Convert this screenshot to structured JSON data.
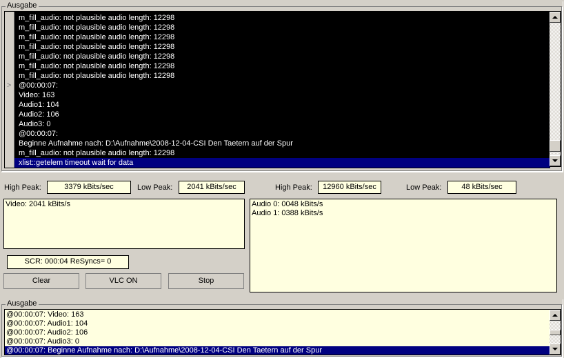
{
  "top_group": {
    "title": "Ausgabe",
    "console": {
      "gutter_marker": ">",
      "lines": [
        "m_fill_audio: not plausible audio length: 12298",
        "m_fill_audio: not plausible audio length: 12298",
        "m_fill_audio: not plausible audio length: 12298",
        "m_fill_audio: not plausible audio length: 12298",
        "m_fill_audio: not plausible audio length: 12298",
        "m_fill_audio: not plausible audio length: 12298",
        "m_fill_audio: not plausible audio length: 12298",
        "@00:00:07:",
        "Video: 163",
        "Audio1: 104",
        "Audio2: 106",
        "Audio3: 0",
        "@00:00:07:",
        "Beginne Aufnahme nach: D:\\Aufnahme\\2008-12-04-CSI Den Taetern auf der Spur",
        "m_fill_audio: not plausible audio length: 12298",
        "xlist::getelem timeout wait for data"
      ],
      "selected_line_index": 15
    }
  },
  "stats": {
    "video_high_peak_label": "High Peak:",
    "video_high_peak_value": "3379 kBits/sec",
    "video_low_peak_label": "Low Peak:",
    "video_low_peak_value": "2041 kBits/sec",
    "audio_high_peak_label": "High Peak:",
    "audio_high_peak_value": "12960 kBits/sec",
    "audio_low_peak_label": "Low Peak:",
    "audio_low_peak_value": "48 kBits/sec",
    "video_panel_lines": [
      "Video: 2041 kBits/s"
    ],
    "audio_panel_lines": [
      "Audio 0: 0048 kBits/s",
      "Audio 1: 0388 kBits/s"
    ],
    "scr_value": "SCR: 000:04 ReSyncs= 0"
  },
  "buttons": {
    "clear": "Clear",
    "vlc": "VLC ON",
    "stop": "Stop"
  },
  "bottom_group": {
    "title": "Ausgabe",
    "rows": [
      "@00:00:07: Video: 163",
      "@00:00:07: Audio1: 104",
      "@00:00:07: Audio2: 106",
      "@00:00:07: Audio3: 0",
      "@00:00:07: Beginne Aufnahme nach: D:\\Aufnahme\\2008-12-04-CSI Den Taetern auf der Spur"
    ],
    "selected_row_index": 4
  },
  "colors": {
    "face": "#d4d0c8",
    "console_bg": "#000000",
    "console_fg": "#ffffff",
    "selection": "#000080",
    "field_bg": "#ffffe0"
  }
}
